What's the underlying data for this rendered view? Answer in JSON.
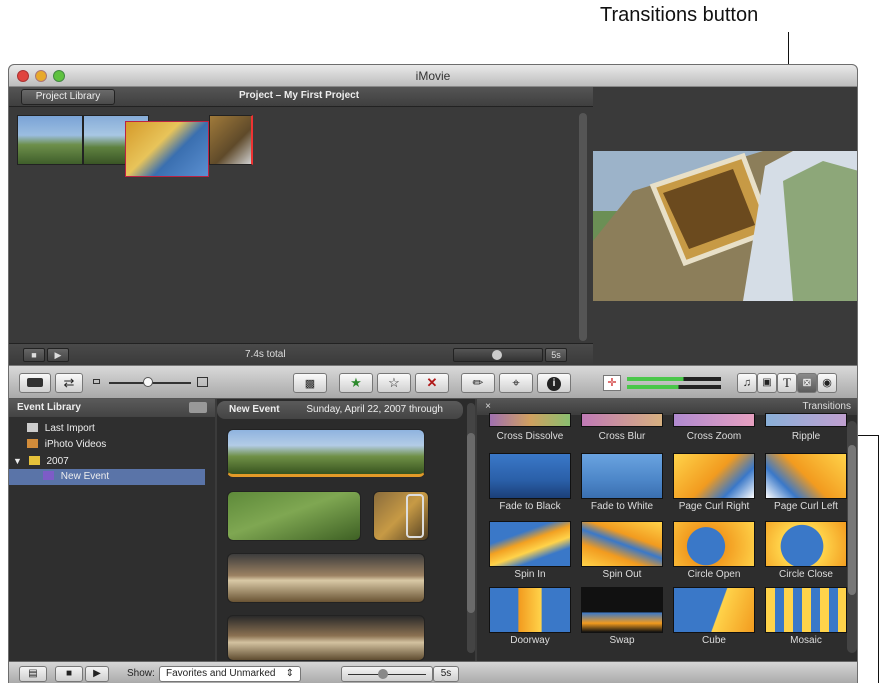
{
  "callout": {
    "text": "Transitions button"
  },
  "window": {
    "title": "iMovie",
    "project_library_button": "Project Library",
    "project_title": "Project – My First Project",
    "project_total": "7.4s total",
    "zoom_label_top": "5s"
  },
  "event_library": {
    "header": "Event Library",
    "items": [
      {
        "label": "Last Import"
      },
      {
        "label": "iPhoto Videos"
      },
      {
        "label": "2007"
      },
      {
        "label": "New Event"
      }
    ]
  },
  "event_browser": {
    "event_name": "New Event",
    "event_date": "Sunday, April 22, 2007 through"
  },
  "transitions": {
    "header": "Transitions",
    "close_label": "×",
    "tiles": [
      {
        "label": "Cross Dissolve"
      },
      {
        "label": "Cross Blur"
      },
      {
        "label": "Cross Zoom"
      },
      {
        "label": "Ripple"
      },
      {
        "label": "Fade to Black"
      },
      {
        "label": "Fade to White"
      },
      {
        "label": "Page Curl Right"
      },
      {
        "label": "Page Curl Left"
      },
      {
        "label": "Spin In"
      },
      {
        "label": "Spin Out"
      },
      {
        "label": "Circle Open"
      },
      {
        "label": "Circle Close"
      },
      {
        "label": "Doorway"
      },
      {
        "label": "Swap"
      },
      {
        "label": "Cube"
      },
      {
        "label": "Mosaic"
      }
    ]
  },
  "bottombar": {
    "show_label": "Show:",
    "show_value": "Favorites and Unmarked",
    "zoom_label": "5s"
  },
  "toolbar": {
    "icons": [
      "camera-icon",
      "swap-icon",
      "zoom-slider",
      "crop-icon",
      "favorite-icon",
      "unfavorite-icon",
      "reject-icon",
      "voiceover-icon",
      "crop-tool-icon",
      "info-icon",
      "volume-meter",
      "music-icon",
      "photo-icon",
      "title-icon",
      "transitions-icon",
      "maps-icon"
    ],
    "title_glyph": "T",
    "reject_glyph": "✕",
    "info_glyph": "i"
  },
  "colors": {
    "accent_selection": "#5a74a8",
    "favorite_green": "#2d8a2d",
    "reject_red": "#b01818"
  }
}
